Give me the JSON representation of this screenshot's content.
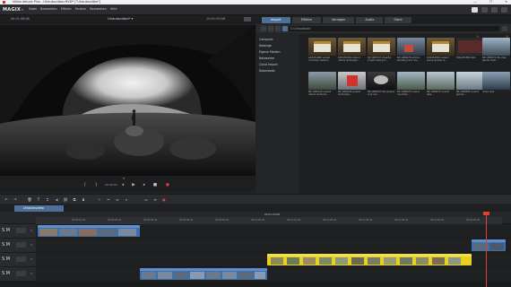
{
  "titlebar": {
    "title": "Video deluxe Plus - Urlaubsvideo.MVD* [\"Urlaubsvideo\"]",
    "controls": [
      "—",
      "☐",
      "✕"
    ]
  },
  "menubar": {
    "logo": "MAGIX",
    "logo_chev": "▾",
    "menus": [
      "Datei",
      "Bearbeiten",
      "Effekte",
      "Fenster",
      "Bearbeiten",
      "Hilfe"
    ]
  },
  "topright_icons": [
    "settings-icon",
    "window-icon",
    "grid-icon",
    "help-icon"
  ],
  "preview": {
    "title": "Urlaubsvideo*",
    "title_chev": "▾",
    "time_left": "00:01:08:08",
    "time_right": "00:01:59:08",
    "transport_label": "Kreis",
    "transport_time": "00:00:00"
  },
  "media_tabs": [
    "Import",
    "Effekte",
    "Vorlagen",
    "Audio",
    "Store"
  ],
  "selected_tab": "Import",
  "media_path": "C:\\Urlaubsbild",
  "sidebar_items": [
    "Computer",
    "Kataloge",
    "Eigene Medien",
    "Netzwerke",
    "Cloud Import",
    "Downloads"
  ],
  "thumbnails": [
    {
      "label": "GX2451080 sunset mountain.iceland..."
    },
    {
      "label": "GX2453030 iceland nature landscape..."
    },
    {
      "label": "DJI 1083737 cheerful couple raising h..."
    },
    {
      "label": "NK 1089278 woman standing rock cav..."
    },
    {
      "label": "GX2451900 iceland scene woman w..."
    },
    {
      "label": "Hotel Buffet.mp4"
    },
    {
      "label": "NK 1089574 life view glacial melt..."
    },
    {
      "label": "NK 1085149 iceland nature landscap..."
    },
    {
      "label": "NK 1080246 iceland landscape..."
    },
    {
      "label": "NK 1089247 two people rock cav..."
    },
    {
      "label": "NK 1088425 iceland mountain..."
    },
    {
      "label": "NK 1089432 iceland lake..."
    },
    {
      "label": "NK 1089584 iceland glacier..."
    },
    {
      "label": "NK 1085153 iceland mountain view..."
    },
    {
      "label": "Video.mp4"
    }
  ],
  "project_tab": "Urlaubsvideo",
  "ruler": {
    "current": "00:01:59:08",
    "labels": [
      "00:00:10:00",
      "00:00:20:00",
      "00:00:30:00",
      "00:00:40:00",
      "00:00:50:00",
      "00:01:00:00",
      "00:01:10:00",
      "00:01:20:00",
      "00:01:30:00",
      "00:01:40:00",
      "00:01:50:00",
      "00:02:00:00"
    ]
  },
  "tracks": [
    {
      "label": "S",
      "mute": "M",
      "num": "1"
    },
    {
      "label": "S",
      "mute": "M",
      "num": "2"
    },
    {
      "label": "S",
      "mute": "M",
      "num": "3"
    },
    {
      "label": "S",
      "mute": "M",
      "num": "4"
    }
  ],
  "colors": {
    "accent": "#4e6f98",
    "playhead": "#e0403a",
    "clip_blue": "#3a6fb0",
    "clip_yellow": "#e6d21e"
  }
}
